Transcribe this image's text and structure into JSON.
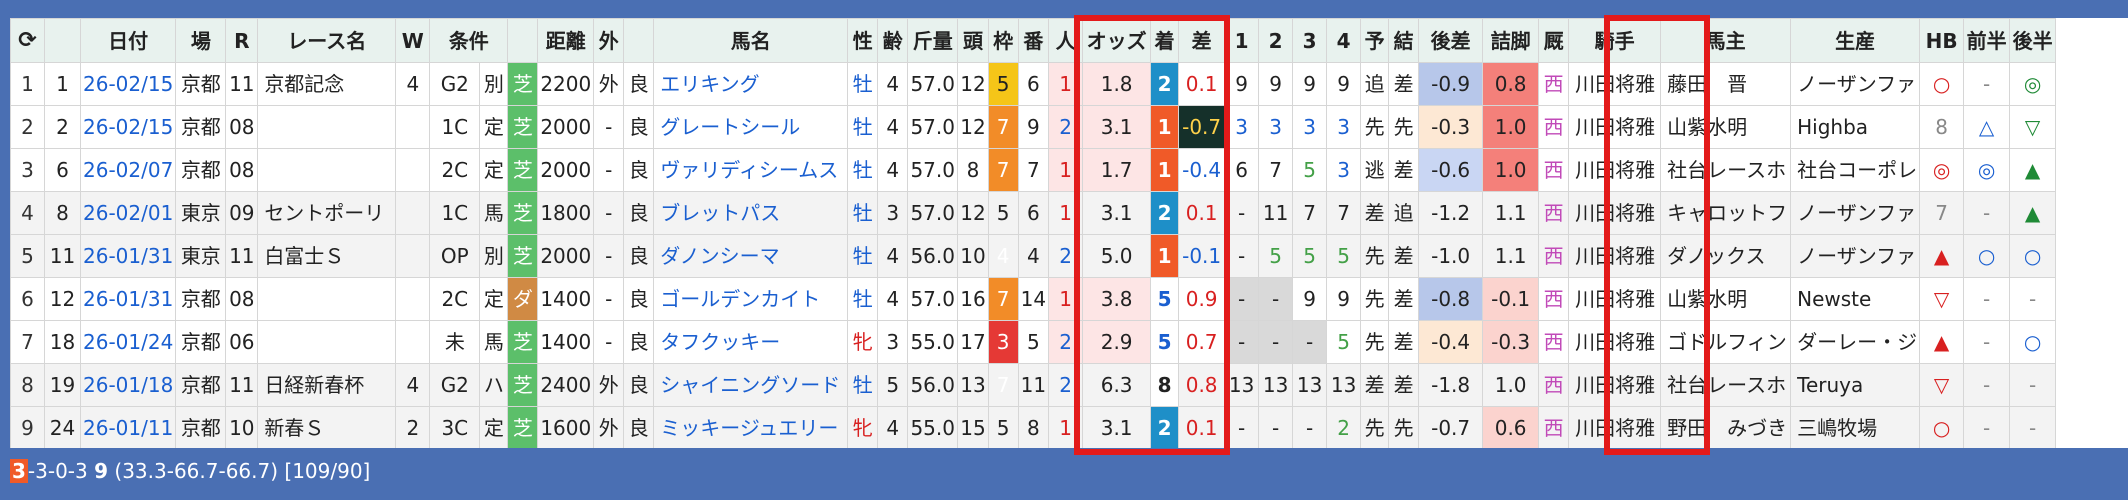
{
  "header": {
    "refresh_icon": "refresh-icon",
    "cols": [
      "",
      "日付",
      "場",
      "R",
      "レース名",
      "W",
      "条件",
      "",
      "",
      "距離",
      "外",
      "",
      "馬名",
      "性",
      "齢",
      "斤量",
      "頭",
      "枠",
      "番",
      "人",
      "オッズ",
      "着",
      "差",
      "1",
      "2",
      "3",
      "4",
      "予",
      "結",
      "後差",
      "詰脚",
      "厩",
      "騎手",
      "馬主",
      "生産",
      "HB",
      "前半",
      "後半"
    ]
  },
  "rows": [
    {
      "idx": "1",
      "no": "1",
      "date": "26-02/15",
      "place": "京都",
      "r": "11",
      "race": "京都記念",
      "w": "4",
      "cond": "G2",
      "kind": "別",
      "ground": "芝",
      "dist": "2200",
      "out": "外",
      "baba": "良",
      "horse": "エリキング",
      "sex": "牡",
      "age": "4",
      "kin": "57.0",
      "heads": "12",
      "waku": "5",
      "ban": "6",
      "pop": "1",
      "odds": "1.8",
      "res": "2",
      "diff": "0.1",
      "c1": "9",
      "c2": "9",
      "c3": "9",
      "c4": "9",
      "pred": "追",
      "kekka": "差",
      "kousa": "-0.9",
      "tsume": "0.8",
      "kyu": "西",
      "jockey": "川田将雅",
      "owner": "藤田　晋",
      "breeder": "ノーザンファ",
      "hb": "○",
      "mae": "-",
      "ato": "◎"
    },
    {
      "idx": "2",
      "no": "2",
      "date": "26-02/15",
      "place": "京都",
      "r": "08",
      "race": "",
      "w": "",
      "cond": "1C",
      "kind": "定",
      "ground": "芝",
      "dist": "2000",
      "out": "-",
      "baba": "良",
      "horse": "グレートシール",
      "sex": "牡",
      "age": "4",
      "kin": "57.0",
      "heads": "12",
      "waku": "7",
      "ban": "9",
      "pop": "2",
      "odds": "3.1",
      "res": "1",
      "diff": "-0.7",
      "c1": "3",
      "c2": "3",
      "c3": "3",
      "c4": "3",
      "pred": "先",
      "kekka": "先",
      "kousa": "-0.3",
      "tsume": "1.0",
      "kyu": "西",
      "jockey": "川田将雅",
      "owner": "山紫水明",
      "breeder": "Highba",
      "hb": "8",
      "mae": "△",
      "ato": "▽"
    },
    {
      "idx": "3",
      "no": "6",
      "date": "26-02/07",
      "place": "京都",
      "r": "08",
      "race": "",
      "w": "",
      "cond": "2C",
      "kind": "定",
      "ground": "芝",
      "dist": "2000",
      "out": "-",
      "baba": "良",
      "horse": "ヴァリディシームス",
      "sex": "牡",
      "age": "4",
      "kin": "57.0",
      "heads": "8",
      "waku": "7",
      "ban": "7",
      "pop": "1",
      "odds": "1.7",
      "res": "1",
      "diff": "-0.4",
      "c1": "6",
      "c2": "7",
      "c3": "5",
      "c4": "3",
      "pred": "逃",
      "kekka": "差",
      "kousa": "-0.6",
      "tsume": "1.0",
      "kyu": "西",
      "jockey": "川田将雅",
      "owner": "社台レースホ",
      "breeder": "社台コーポレ",
      "hb": "◎",
      "mae": "◎",
      "ato": "▲"
    },
    {
      "idx": "4",
      "no": "8",
      "date": "26-02/01",
      "place": "東京",
      "r": "09",
      "race": "セントポーリ",
      "w": "",
      "cond": "1C",
      "kind": "馬",
      "ground": "芝",
      "dist": "1800",
      "out": "-",
      "baba": "良",
      "horse": "ブレットパス",
      "sex": "牡",
      "age": "3",
      "kin": "57.0",
      "heads": "12",
      "waku": "5",
      "ban": "6",
      "pop": "1",
      "odds": "3.1",
      "res": "2",
      "diff": "0.1",
      "c1": "-",
      "c2": "11",
      "c3": "7",
      "c4": "7",
      "pred": "差",
      "kekka": "追",
      "kousa": "-1.2",
      "tsume": "1.1",
      "kyu": "西",
      "jockey": "川田将雅",
      "owner": "キャロットフ",
      "breeder": "ノーザンファ",
      "hb": "7",
      "mae": "-",
      "ato": "▲"
    },
    {
      "idx": "5",
      "no": "11",
      "date": "26-01/31",
      "place": "東京",
      "r": "11",
      "race": "白富士Ｓ",
      "w": "",
      "cond": "OP",
      "kind": "別",
      "ground": "芝",
      "dist": "2000",
      "out": "-",
      "baba": "良",
      "horse": "ダノンシーマ",
      "sex": "牡",
      "age": "4",
      "kin": "56.0",
      "heads": "10",
      "waku": "4",
      "ban": "4",
      "pop": "2",
      "odds": "5.0",
      "res": "1",
      "diff": "-0.1",
      "c1": "-",
      "c2": "5",
      "c3": "5",
      "c4": "5",
      "pred": "先",
      "kekka": "差",
      "kousa": "-1.0",
      "tsume": "1.1",
      "kyu": "西",
      "jockey": "川田将雅",
      "owner": "ダノックス",
      "breeder": "ノーザンファ",
      "hb": "▲",
      "mae": "○",
      "ato": "○"
    },
    {
      "idx": "6",
      "no": "12",
      "date": "26-01/31",
      "place": "京都",
      "r": "08",
      "race": "",
      "w": "",
      "cond": "2C",
      "kind": "定",
      "ground": "ダ",
      "dist": "1400",
      "out": "-",
      "baba": "良",
      "horse": "ゴールデンカイト",
      "sex": "牡",
      "age": "4",
      "kin": "57.0",
      "heads": "16",
      "waku": "7",
      "ban": "14",
      "pop": "1",
      "odds": "3.8",
      "res": "5",
      "diff": "0.9",
      "c1": "-",
      "c2": "-",
      "c3": "9",
      "c4": "9",
      "pred": "先",
      "kekka": "差",
      "kousa": "-0.8",
      "tsume": "-0.1",
      "kyu": "西",
      "jockey": "川田将雅",
      "owner": "山紫水明",
      "breeder": "Newste",
      "hb": "▽",
      "mae": "-",
      "ato": "-"
    },
    {
      "idx": "7",
      "no": "18",
      "date": "26-01/24",
      "place": "京都",
      "r": "06",
      "race": "",
      "w": "",
      "cond": "未",
      "kind": "馬",
      "ground": "芝",
      "dist": "1400",
      "out": "-",
      "baba": "良",
      "horse": "タフクッキー",
      "sex": "牝",
      "age": "3",
      "kin": "55.0",
      "heads": "17",
      "waku": "3",
      "ban": "5",
      "pop": "2",
      "odds": "2.9",
      "res": "5",
      "diff": "0.7",
      "c1": "-",
      "c2": "-",
      "c3": "-",
      "c4": "5",
      "pred": "先",
      "kekka": "差",
      "kousa": "-0.4",
      "tsume": "-0.3",
      "kyu": "西",
      "jockey": "川田将雅",
      "owner": "ゴドルフィン",
      "breeder": "ダーレー・ジ",
      "hb": "▲",
      "mae": "-",
      "ato": "○"
    },
    {
      "idx": "8",
      "no": "19",
      "date": "26-01/18",
      "place": "京都",
      "r": "11",
      "race": "日経新春杯",
      "w": "4",
      "cond": "G2",
      "kind": "ハ",
      "ground": "芝",
      "dist": "2400",
      "out": "外",
      "baba": "良",
      "horse": "シャイニングソード",
      "sex": "牡",
      "age": "5",
      "kin": "56.0",
      "heads": "13",
      "waku": "7",
      "ban": "11",
      "pop": "2",
      "odds": "6.3",
      "res": "8",
      "diff": "0.8",
      "c1": "13",
      "c2": "13",
      "c3": "13",
      "c4": "13",
      "pred": "差",
      "kekka": "差",
      "kousa": "-1.8",
      "tsume": "1.0",
      "kyu": "西",
      "jockey": "川田将雅",
      "owner": "社台レースホ",
      "breeder": "Teruya",
      "hb": "▽",
      "mae": "-",
      "ato": "-"
    },
    {
      "idx": "9",
      "no": "24",
      "date": "26-01/11",
      "place": "京都",
      "r": "10",
      "race": "新春Ｓ",
      "w": "2",
      "cond": "3C",
      "kind": "定",
      "ground": "芝",
      "dist": "1600",
      "out": "外",
      "baba": "良",
      "horse": "ミッキージュエリー",
      "sex": "牝",
      "age": "4",
      "kin": "55.0",
      "heads": "15",
      "waku": "5",
      "ban": "8",
      "pop": "1",
      "odds": "3.1",
      "res": "2",
      "diff": "0.1",
      "c1": "-",
      "c2": "-",
      "c3": "-",
      "c4": "2",
      "pred": "先",
      "kekka": "先",
      "kousa": "-0.7",
      "tsume": "0.6",
      "kyu": "西",
      "jockey": "川田将雅",
      "owner": "野田　みづき",
      "breeder": "三嶋牧場",
      "hb": "○",
      "mae": "-",
      "ato": "-"
    }
  ],
  "summary": {
    "first": "3",
    "record": "-3-0-3",
    "count": "9",
    "rates": "(33.3-66.7-66.7)",
    "rank": "[109/90]"
  },
  "colors": {
    "page_bg": "#4a6fb3",
    "highlight": "#e31a1a",
    "result1": "#f05a28",
    "result2": "#1e8fc8",
    "shiba": "#5cbf6a",
    "dirt": "#d08a44"
  }
}
